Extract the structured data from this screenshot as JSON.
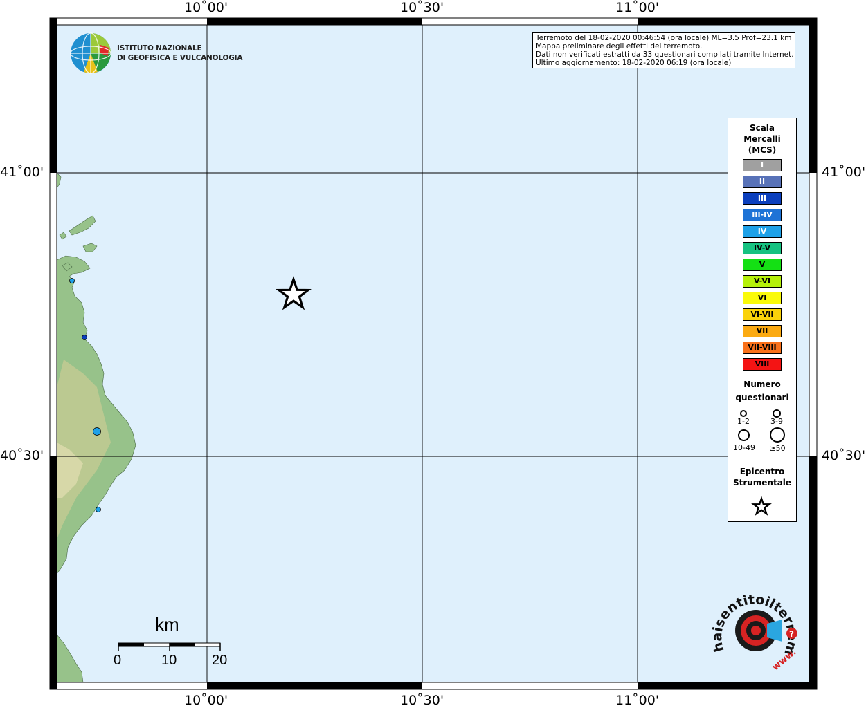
{
  "map": {
    "lon_labels": [
      "10˚00'",
      "10˚30'",
      "11˚00'"
    ],
    "lat_labels": [
      "41˚00'",
      "40˚30'"
    ],
    "colors": {
      "sea": "#dff0fc",
      "land": "#97c28a",
      "frame": "#000000"
    }
  },
  "info": {
    "line1": "Terremoto del 18-02-2020 00:46:54 (ora locale) ML=3.5 Prof=23.1 km",
    "line2": "Mappa preliminare degli effetti del terremoto.",
    "line3": "Dati non verificati estratti da 33 questionari compilati tramite Internet.",
    "line4": "Ultimo aggiornamento: 18-02-2020 06:19 (ora locale)"
  },
  "logos": {
    "ingv_line1": "ISTITUTO NAZIONALE",
    "ingv_line2": "DI GEOFISICA E VULCANOLOGIA",
    "hai_text": "haisentitoilterremoto.it",
    "hai_www": "www."
  },
  "legend": {
    "scale_title_1": "Scala",
    "scale_title_2": "Mercalli",
    "scale_title_3": "(MCS)",
    "intensities": [
      {
        "label": "I",
        "color": "#a0a0a0",
        "text_color": "#ffffff"
      },
      {
        "label": "II",
        "color": "#5872b8",
        "text_color": "#ffffff"
      },
      {
        "label": "III",
        "color": "#0b3fbd",
        "text_color": "#ffffff"
      },
      {
        "label": "III-IV",
        "color": "#1e73d6",
        "text_color": "#ffffff"
      },
      {
        "label": "IV",
        "color": "#1ea1e8",
        "text_color": "#ffffff"
      },
      {
        "label": "IV-V",
        "color": "#16c281",
        "text_color": "#000000"
      },
      {
        "label": "V",
        "color": "#14e014",
        "text_color": "#000000"
      },
      {
        "label": "V-VI",
        "color": "#b5f00a",
        "text_color": "#000000"
      },
      {
        "label": "VI",
        "color": "#fafa0a",
        "text_color": "#000000"
      },
      {
        "label": "VI-VII",
        "color": "#fad20a",
        "text_color": "#000000"
      },
      {
        "label": "VII",
        "color": "#fbaa12",
        "text_color": "#000000"
      },
      {
        "label": "VII-VIII",
        "color": "#f8701a",
        "text_color": "#000000"
      },
      {
        "label": "VIII",
        "color": "#f41414",
        "text_color": "#000000"
      }
    ],
    "questionnaire_title_1": "Numero",
    "questionnaire_title_2": "questionari",
    "size_labels": [
      "1-2",
      "3-9",
      "10-49",
      "≥50"
    ],
    "epicenter_title_1": "Epicentro",
    "epicenter_title_2": "Strumentale"
  },
  "scale_bar": {
    "unit": "km",
    "ticks": [
      "0",
      "10",
      "20"
    ]
  }
}
